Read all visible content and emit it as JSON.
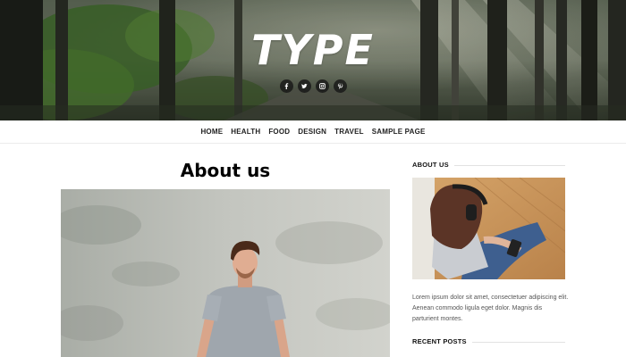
{
  "site": {
    "logo": "TYPE",
    "social": [
      {
        "icon": "facebook-icon",
        "glyph": "f"
      },
      {
        "icon": "twitter-icon",
        "glyph": "t"
      },
      {
        "icon": "instagram-icon",
        "glyph": "ig"
      },
      {
        "icon": "pinterest-icon",
        "glyph": "p"
      }
    ]
  },
  "nav": {
    "items": [
      "HOME",
      "HEALTH",
      "FOOD",
      "DESIGN",
      "TRAVEL",
      "SAMPLE PAGE"
    ]
  },
  "main": {
    "title": "About us",
    "featured_image": "man-in-grey-tshirt-against-wall"
  },
  "sidebar": {
    "about_title": "ABOUT US",
    "about_image": "woman-with-headphones-using-phone",
    "about_text": "Lorem ipsum dolor sit amet, consectetuer adipiscing elit. Aenean commodo ligula eget dolor. Magnis dis parturient montes.",
    "recent_title": "RECENT POSTS"
  },
  "colors": {
    "text": "#1a1a1a",
    "muted": "#555555",
    "rule": "#e2e2e2",
    "hero_overlay": "#3b4439"
  }
}
